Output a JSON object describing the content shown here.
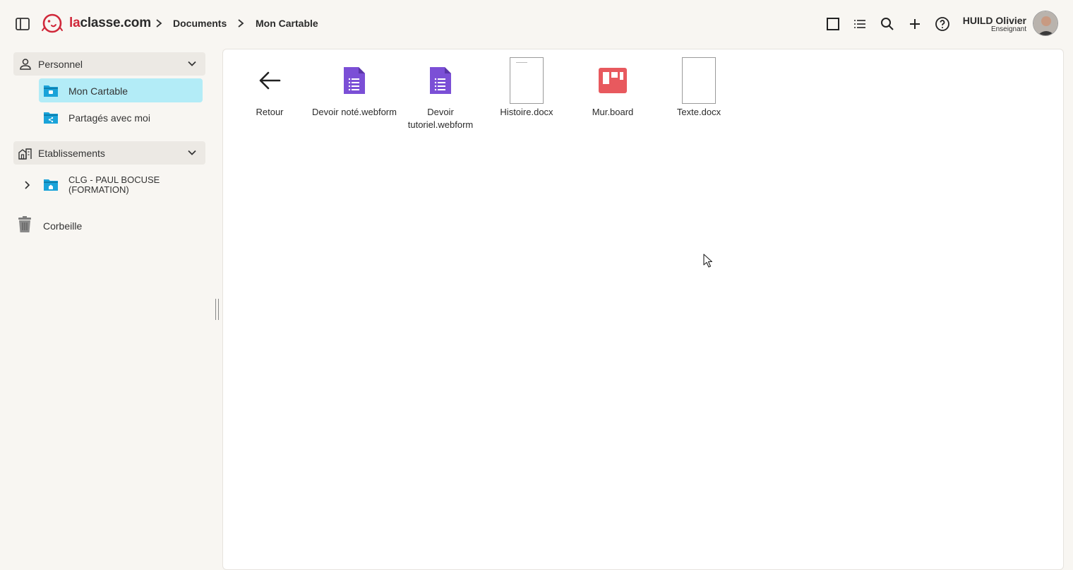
{
  "header": {
    "logo_text_accent": "la",
    "logo_text_rest": "classe.com",
    "breadcrumb": [
      "Documents",
      "Mon Cartable"
    ],
    "user": {
      "name": "HUILD Olivier",
      "role": "Enseignant"
    }
  },
  "sidebar": {
    "personnel_label": "Personnel",
    "mon_cartable_label": "Mon Cartable",
    "partages_label": "Partagés avec moi",
    "etablissements_label": "Etablissements",
    "etablissement_item_label": "CLG - PAUL BOCUSE (FORMATION)",
    "corbeille_label": "Corbeille"
  },
  "files": [
    {
      "label": "Retour",
      "icon": "arrow-left-icon"
    },
    {
      "label": "Devoir noté.webform",
      "icon": "webform-icon"
    },
    {
      "label": "Devoir tutoriel.webform",
      "icon": "webform-icon"
    },
    {
      "label": "Histoire.docx",
      "icon": "docx-thumbnail"
    },
    {
      "label": "Mur.board",
      "icon": "board-icon"
    },
    {
      "label": "Texte.docx",
      "icon": "docx-thumbnail"
    }
  ],
  "colors": {
    "brand": "#d0283a",
    "active_item": "#b3ecf7",
    "folder": "#1aa3d9",
    "webform": "#7b4fd6",
    "board": "#e8595e"
  }
}
